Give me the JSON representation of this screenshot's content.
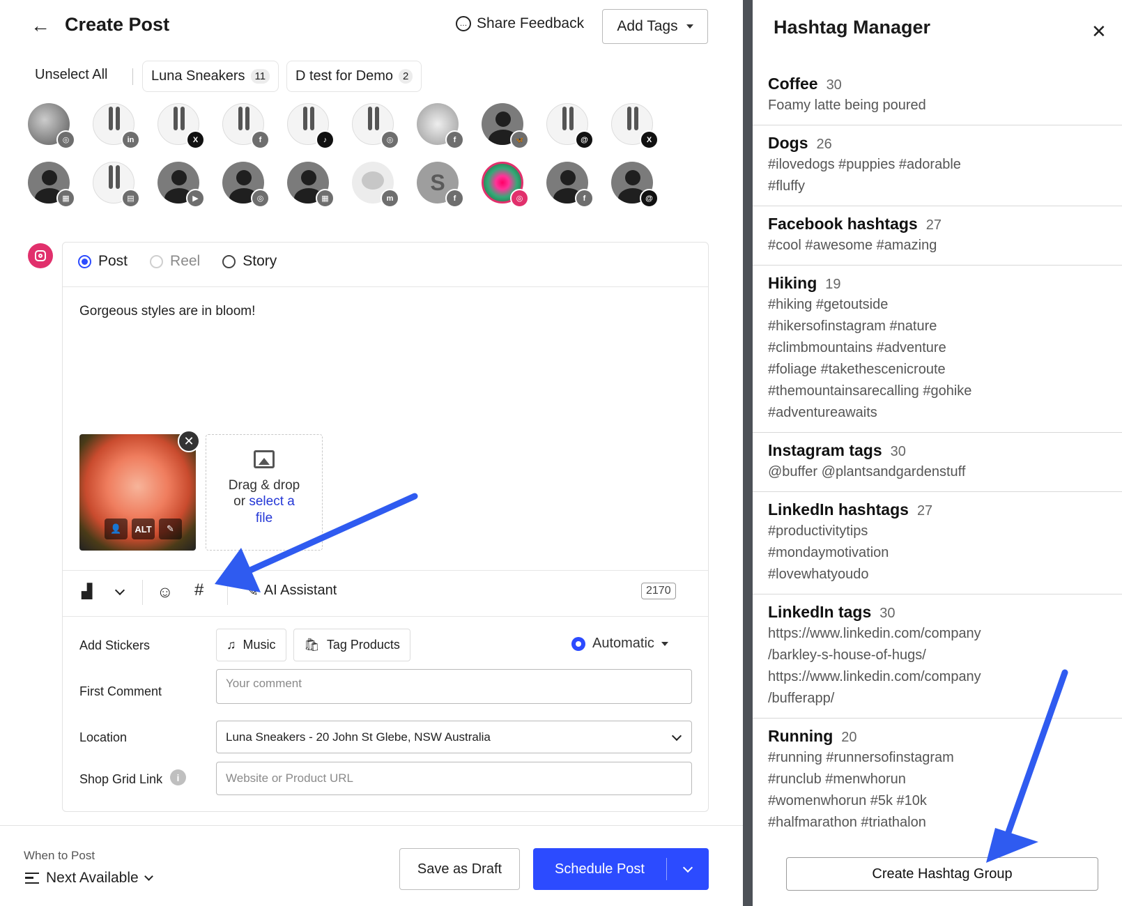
{
  "header": {
    "back_icon": "back-arrow-icon",
    "title": "Create Post",
    "share_feedback": "Share Feedback",
    "add_tags": "Add Tags"
  },
  "profiles_bar": {
    "unselect_all": "Unselect All",
    "groups": [
      {
        "label": "Luna Sneakers",
        "count": "11"
      },
      {
        "label": "D test for Demo",
        "count": "2"
      }
    ]
  },
  "avatars": [
    {
      "kind": "photo",
      "network": "instagram",
      "badge": "◎"
    },
    {
      "kind": "legs",
      "network": "linkedin",
      "badge": "in"
    },
    {
      "kind": "legs",
      "network": "x",
      "badge": "X"
    },
    {
      "kind": "legs",
      "network": "facebook",
      "badge": "f"
    },
    {
      "kind": "legs",
      "network": "tiktok",
      "badge": "♪"
    },
    {
      "kind": "legs",
      "network": "instagram",
      "badge": "◎"
    },
    {
      "kind": "photo2",
      "network": "facebook",
      "badge": "f"
    },
    {
      "kind": "person",
      "network": "bluesky",
      "badge": "🦋"
    },
    {
      "kind": "legs",
      "network": "threads",
      "badge": "@"
    },
    {
      "kind": "legs",
      "network": "x",
      "badge": "X"
    },
    {
      "kind": "person",
      "network": "google-business",
      "badge": "▦"
    },
    {
      "kind": "legs",
      "network": "startpage",
      "badge": "▤"
    },
    {
      "kind": "person",
      "network": "youtube",
      "badge": "▶"
    },
    {
      "kind": "person",
      "network": "instagram",
      "badge": "◎"
    },
    {
      "kind": "person",
      "network": "google-business",
      "badge": "▦"
    },
    {
      "kind": "elephant",
      "network": "mastodon",
      "badge": "m"
    },
    {
      "kind": "s",
      "network": "facebook",
      "badge": "f"
    },
    {
      "kind": "flower",
      "network": "instagram",
      "badge": "◎"
    },
    {
      "kind": "person",
      "network": "facebook",
      "badge": "f"
    },
    {
      "kind": "person",
      "network": "threads",
      "badge": "@"
    }
  ],
  "composer": {
    "post_types": [
      {
        "label": "Post",
        "state": "selected"
      },
      {
        "label": "Reel",
        "state": "disabled"
      },
      {
        "label": "Story",
        "state": "unselected"
      }
    ],
    "text": "Gorgeous styles are in bloom!",
    "media": {
      "alt_label": "ALT",
      "drop_line1": "Drag & drop",
      "drop_or": "or ",
      "drop_link1": "select a",
      "drop_link2": "file"
    },
    "toolbar": {
      "ai_assistant": "AI Assistant",
      "char_count": "2170"
    },
    "stickers": {
      "label": "Add Stickers",
      "music": "Music",
      "tag_products": "Tag Products",
      "mode": "Automatic"
    },
    "first_comment": {
      "label": "First Comment",
      "placeholder": "Your comment"
    },
    "location": {
      "label": "Location",
      "value": "Luna Sneakers - 20 John St Glebe, NSW Australia"
    },
    "shop_grid": {
      "label": "Shop Grid Link",
      "placeholder": "Website or Product URL"
    }
  },
  "footer": {
    "when_label": "When to Post",
    "when_value": "Next Available",
    "save_draft": "Save as Draft",
    "schedule": "Schedule Post"
  },
  "hashtag_manager": {
    "title": "Hashtag Manager",
    "groups": [
      {
        "name": "Coffee",
        "count": "30",
        "tags": "Foamy latte being poured"
      },
      {
        "name": "Dogs",
        "count": "26",
        "tags": "#ilovedogs #puppies #adorable\n#fluffy"
      },
      {
        "name": "Facebook hashtags",
        "count": "27",
        "tags": "#cool #awesome #amazing"
      },
      {
        "name": "Hiking",
        "count": "19",
        "tags": "#hiking #getoutside\n#hikersofinstagram #nature\n#climbmountains #adventure\n#foliage #takethescenicroute\n#themountainsarecalling #gohike\n#adventureawaits"
      },
      {
        "name": "Instagram tags",
        "count": "30",
        "tags": "@buffer @plantsandgardenstuff"
      },
      {
        "name": "LinkedIn hashtags",
        "count": "27",
        "tags": "#productivitytips\n#mondaymotivation\n#lovewhatyoudo"
      },
      {
        "name": "LinkedIn tags",
        "count": "30",
        "tags": "https://www.linkedin.com/company\n/barkley-s-house-of-hugs/\nhttps://www.linkedin.com/company\n/bufferapp/"
      },
      {
        "name": "Running",
        "count": "20",
        "tags": "#running #runnersofinstagram\n#runclub #menwhorun\n#womenwhorun #5k #10k\n#halfmarathon #triathalon"
      }
    ],
    "create_button": "Create Hashtag Group"
  },
  "colors": {
    "accent": "#2c4bff",
    "instagram": "#e1306c",
    "divider": "#4d5157",
    "annotation_arrow": "#2f5bf0"
  }
}
